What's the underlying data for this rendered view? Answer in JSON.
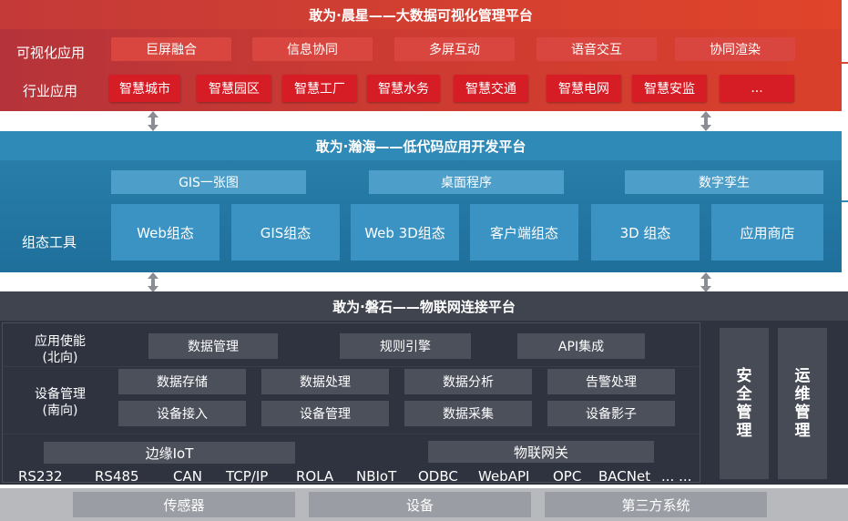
{
  "top_platform": {
    "title": "敢为·晨星——大数据可视化管理平台",
    "visual_label": "可视化应用",
    "visual_items": [
      "巨屏融合",
      "信息协同",
      "多屏互动",
      "语音交互",
      "协同渲染"
    ],
    "industry_label": "行业应用",
    "industry_items": [
      "智慧城市",
      "智慧园区",
      "智慧工厂",
      "智慧水务",
      "智慧交通",
      "智慧电网",
      "智慧安监",
      "..."
    ]
  },
  "mid_platform": {
    "title": "敢为·瀚海——低代码应用开发平台",
    "top_items": [
      "GIS一张图",
      "桌面程序",
      "数字孪生"
    ],
    "tools_label": "组态工具",
    "tool_items": [
      "Web组态",
      "GIS组态",
      "Web 3D组态",
      "客户端组态",
      "3D 组态",
      "应用商店"
    ]
  },
  "iot_platform": {
    "title": "敢为·磐石——物联网连接平台",
    "north_label_line1": "应用使能",
    "north_label_line2": "(北向)",
    "north_items": [
      "数据管理",
      "规则引擎",
      "API集成"
    ],
    "south_label_line1": "设备管理",
    "south_label_line2": "(南向)",
    "south_row1": [
      "数据存储",
      "数据处理",
      "数据分析",
      "告警处理"
    ],
    "south_row2": [
      "设备接入",
      "设备管理",
      "数据采集",
      "设备影子"
    ],
    "edge_label": "边缘IoT",
    "gateway_label": "物联网关",
    "protocols": [
      "RS232",
      "RS485",
      "CAN",
      "TCP/IP",
      "ROLA",
      "NBIoT",
      "ODBC",
      "WebAPI",
      "OPC",
      "BACNet",
      "... ..."
    ],
    "security_chars": [
      "安",
      "全",
      "管",
      "理"
    ],
    "ops_chars": [
      "运",
      "维",
      "管",
      "理"
    ]
  },
  "sources": [
    "传感器",
    "设备",
    "第三方系统"
  ],
  "colors": {
    "top_layer": "#cc3b32",
    "mid_layer": "#2a82ad",
    "bottom_layer": "#2f3340",
    "source_strip": "#b7b9bd"
  },
  "icons": [
    "double-arrow-icon"
  ]
}
